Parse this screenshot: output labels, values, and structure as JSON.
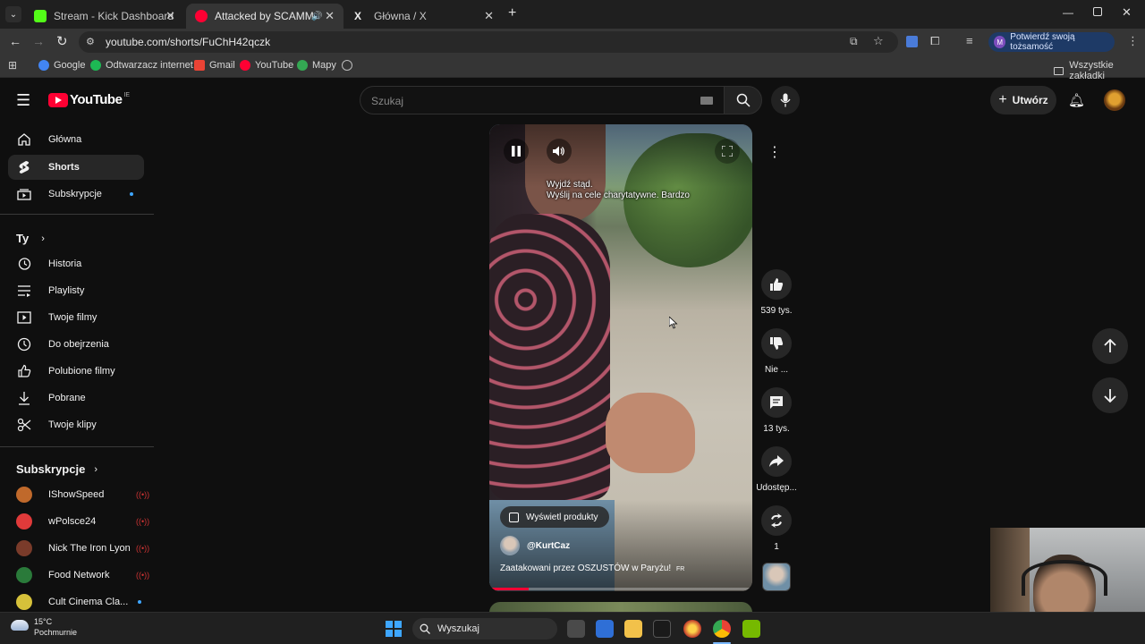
{
  "browser": {
    "tabs": [
      {
        "title": "Stream - Kick Dashboard"
      },
      {
        "title": "Attacked by SCAMMERS in"
      },
      {
        "title": "Główna / X"
      }
    ],
    "url": "youtube.com/shorts/FuChH42qczk",
    "profile_button": "Potwierdź swoją tożsamość",
    "profile_initial": "M",
    "bookmarks": [
      "Google",
      "Odtwarzacz internet...",
      "Gmail",
      "YouTube",
      "Mapy"
    ],
    "all_bookmarks": "Wszystkie zakładki"
  },
  "youtube": {
    "logo_text": "YouTube",
    "logo_region": "IE",
    "search_placeholder": "Szukaj",
    "create_label": "Utwórz",
    "nav": [
      {
        "label": "Główna",
        "icon": "home-icon"
      },
      {
        "label": "Shorts",
        "icon": "shorts-icon"
      },
      {
        "label": "Subskrypcje",
        "icon": "subscriptions-icon"
      }
    ],
    "you_section": "Ty",
    "you_items": [
      {
        "label": "Historia",
        "icon": "history-icon"
      },
      {
        "label": "Playlisty",
        "icon": "playlist-icon"
      },
      {
        "label": "Twoje filmy",
        "icon": "your-videos-icon"
      },
      {
        "label": "Do obejrzenia",
        "icon": "watch-later-icon"
      },
      {
        "label": "Polubione filmy",
        "icon": "liked-icon"
      },
      {
        "label": "Pobrane",
        "icon": "download-icon"
      },
      {
        "label": "Twoje klipy",
        "icon": "clips-icon"
      }
    ],
    "subs_section": "Subskrypcje",
    "subscriptions": [
      {
        "name": "IShowSpeed",
        "live": true,
        "color": "#c0692b"
      },
      {
        "name": "wPolsce24",
        "live": true,
        "color": "#e03a3a"
      },
      {
        "name": "Nick The Iron Lyon",
        "live": true,
        "color": "#7a3b2a"
      },
      {
        "name": "Food Network",
        "live": true,
        "color": "#2a7a3a"
      },
      {
        "name": "Cult Cinema Cla...",
        "live": false,
        "color": "#d6c13a"
      }
    ],
    "short": {
      "caption_line1": "Wyjdź stąd.",
      "caption_line2": "Wyślij na cele charytatywne.  Bardzo",
      "products_label": "Wyświetl produkty",
      "channel": "@KurtCaz",
      "title": "Zaatakowani przez OSZUSTÓW w Paryżu!",
      "title_badge": "FR",
      "progress_fraction": 0.15
    },
    "actions": {
      "likes": "539 tys.",
      "dislike": "Nie ...",
      "comments": "13 tys.",
      "share": "Udostęp...",
      "remix": "1"
    }
  },
  "taskbar": {
    "weather_temp": "15°C",
    "weather_desc": "Pochmurnie",
    "search_placeholder": "Wyszukaj"
  }
}
